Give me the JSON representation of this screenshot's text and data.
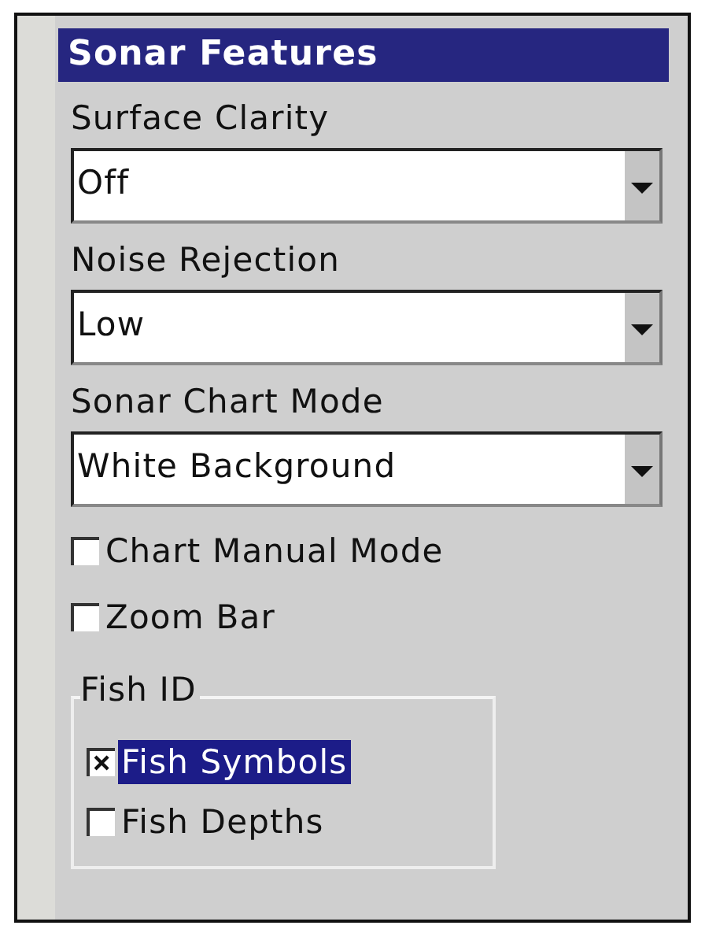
{
  "dialog": {
    "title": "Sonar Features"
  },
  "dropdowns": [
    {
      "label": "Surface Clarity",
      "value": "Off"
    },
    {
      "label": "Noise Rejection",
      "value": "Low"
    },
    {
      "label": "Sonar Chart Mode",
      "value": "White Background"
    }
  ],
  "checkboxes": [
    {
      "label": "Chart Manual Mode",
      "checked": false
    },
    {
      "label": "Zoom Bar",
      "checked": false
    }
  ],
  "fish_id": {
    "title": "Fish ID",
    "options": [
      {
        "label": "Fish Symbols",
        "checked": true,
        "selected": true
      },
      {
        "label": "Fish Depths",
        "checked": false,
        "selected": false
      }
    ]
  }
}
